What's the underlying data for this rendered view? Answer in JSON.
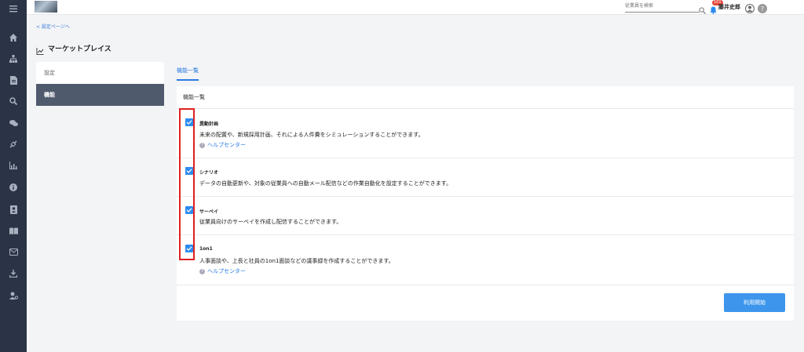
{
  "header": {
    "search_placeholder": "従業員を検索",
    "notification_count": "101",
    "user_name": "藤井史郎"
  },
  "breadcrumb": "< 設定ページへ",
  "page_title": "マーケットプレイス",
  "settings_nav": [
    {
      "label": "設定",
      "active": false
    },
    {
      "label": "機能",
      "active": true
    }
  ],
  "tabs": [
    {
      "label": "機能一覧",
      "active": true
    }
  ],
  "card": {
    "title": "機能一覧",
    "features": [
      {
        "name": "異動計画",
        "checked": true,
        "description": "未来の配置や、新規採用計画、それによる人件費をシミュレーションすることができます。",
        "help": "ヘルプセンター"
      },
      {
        "name": "シナリオ",
        "checked": true,
        "description": "データの自動更新や、対象の従業員への自動メール配信などの作業自動化を設定することができます。"
      },
      {
        "name": "サーベイ",
        "checked": true,
        "description": "従業員向けのサーベイを作成し配信することができます。"
      },
      {
        "name": "1on1",
        "checked": true,
        "description": "人事面談や、上長と社員の1on1面談などの議事録を作成することができます。",
        "help": "ヘルプセンター"
      }
    ],
    "start_button": "利用開始"
  },
  "sidebar_icons": [
    "menu-icon",
    "home-icon",
    "org-chart-icon",
    "document-icon",
    "search-icon",
    "chat-icon",
    "link-icon",
    "chart-icon",
    "info-icon",
    "contact-card-icon",
    "book-icon",
    "mail-icon",
    "download-icon",
    "user-settings-icon"
  ],
  "colors": {
    "sidebar": "#2b3446",
    "accent": "#2d8cf0",
    "active_nav": "#505a6d",
    "highlight": "#e02020"
  }
}
